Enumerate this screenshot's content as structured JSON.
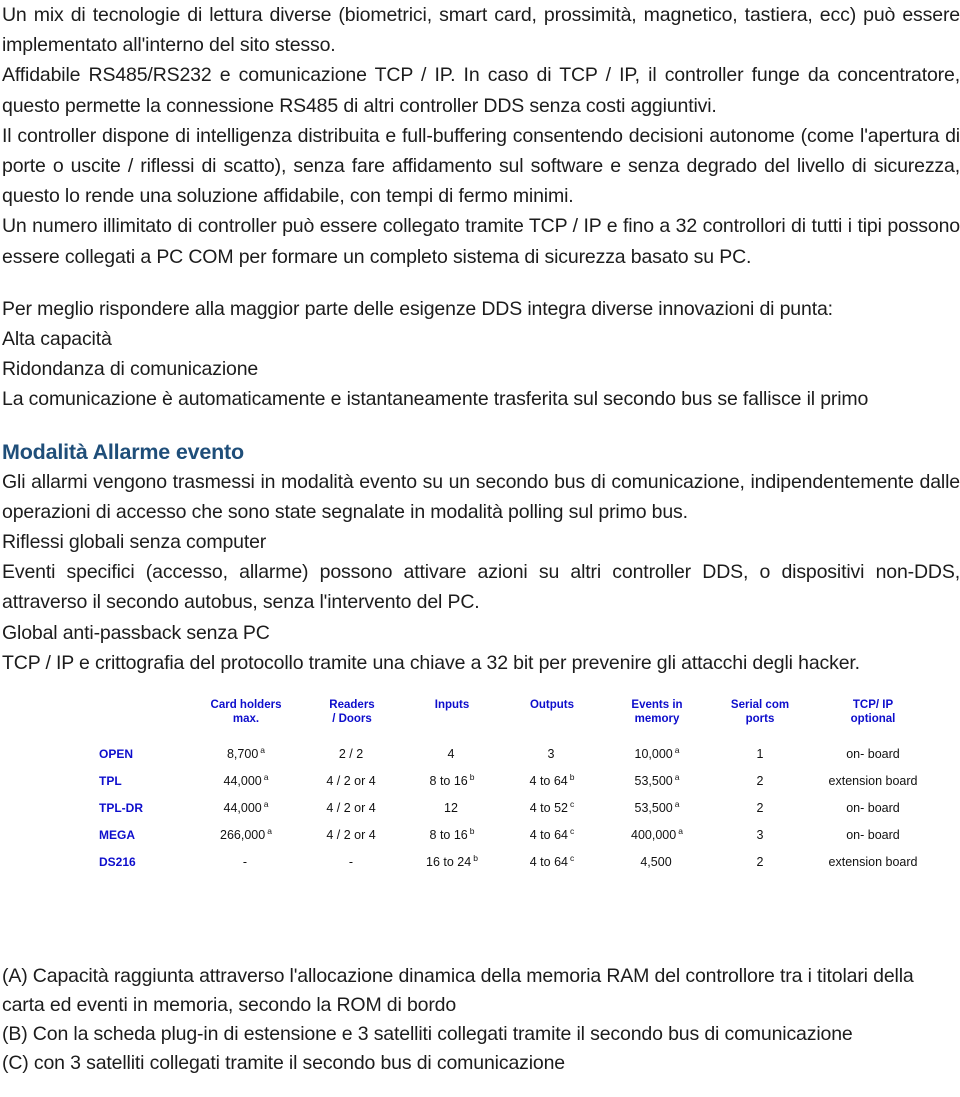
{
  "document": {
    "paragraphs": [
      {
        "id": "p-intro",
        "text": "Un mix di tecnologie di lettura diverse (biometrici, smart card, prossimità, magnetico, tastiera, ecc) può essere implementato all'interno del sito stesso."
      },
      {
        "id": "p-comm",
        "text": "Affidabile RS485/RS232 e comunicazione TCP / IP. In caso di TCP / IP, il controller funge da concentratore, questo permette la connessione RS485 di altri controller DDS senza costi aggiuntivi."
      },
      {
        "id": "p-intelligence",
        "text": "Il controller dispone di intelligenza distribuita e full-buffering consentendo decisioni autonome (come l'apertura di porte o uscite / riflessi di scatto), senza fare affidamento sul software e senza degrado del livello di sicurezza, questo lo rende una soluzione affidabile, con tempi di fermo minimi."
      },
      {
        "id": "p-scaling",
        "text": "Un numero illimitato di controller può essere collegato tramite TCP / IP e fino a 32 controllori di tutti i tipi possono essere collegati a PC COM per formare un completo sistema di sicurezza basato su PC."
      }
    ],
    "innovations": {
      "lead_in": "Per meglio rispondere alla maggior parte delle esigenze DDS integra diverse innovazioni di punta:",
      "items": [
        {
          "title": "Alta capacità",
          "description": ""
        },
        {
          "title": "Ridondanza di comunicazione",
          "description": "La comunicazione è automaticamente e istantaneamente trasferita sul secondo bus se fallisce il primo"
        }
      ]
    },
    "alarm_section": {
      "heading": "Modalità Allarme evento",
      "heading_color": "#1f4e79",
      "body": "Gli allarmi vengono trasmessi in modalità evento su un secondo bus di comunicazione, indipendentemente dalle operazioni di accesso che sono state segnalate in modalità polling sul primo bus.",
      "subsections": [
        {
          "title": "Riflessi globali senza computer",
          "body": "Eventi specifici (accesso, allarme) possono attivare azioni su altri controller DDS, o dispositivi non-DDS, attraverso il secondo autobus, senza l'intervento del PC."
        },
        {
          "title": "Global anti-passback senza PC",
          "body": "TCP / IP e crittografia del protocollo tramite una chiave a 32 bit per prevenire gli attacchi degli hacker."
        }
      ]
    }
  },
  "spec_table": {
    "header_color": "#0d0dcc",
    "columns": [
      {
        "key": "model",
        "line1": "",
        "line2": ""
      },
      {
        "key": "cards",
        "line1": "Card holders",
        "line2": "max."
      },
      {
        "key": "readers",
        "line1": "Readers",
        "line2": "/ Doors"
      },
      {
        "key": "inputs",
        "line1": "Inputs",
        "line2": ""
      },
      {
        "key": "outputs",
        "line1": "Outputs",
        "line2": ""
      },
      {
        "key": "events",
        "line1": "Events in",
        "line2": "memory"
      },
      {
        "key": "serial",
        "line1": "Serial com",
        "line2": "ports"
      },
      {
        "key": "tcp",
        "line1": "TCP/ IP",
        "line2": "optional"
      }
    ],
    "rows": [
      {
        "model": "OPEN",
        "cards": "8,700",
        "cards_fn": "a",
        "readers": "2 / 2",
        "readers_fn": "",
        "inputs": "4",
        "inputs_fn": "",
        "outputs": "3",
        "outputs_fn": "",
        "events": "10,000",
        "events_fn": "a",
        "serial": "1",
        "tcp": "on- board"
      },
      {
        "model": "TPL",
        "cards": "44,000",
        "cards_fn": "a",
        "readers": "4 / 2 or 4",
        "readers_fn": "",
        "inputs": "8 to 16",
        "inputs_fn": "b",
        "outputs": "4 to 64",
        "outputs_fn": "b",
        "events": "53,500",
        "events_fn": "a",
        "serial": "2",
        "tcp": "extension board"
      },
      {
        "model": "TPL-DR",
        "cards": "44,000",
        "cards_fn": "a",
        "readers": "4 / 2 or 4",
        "readers_fn": "",
        "inputs": "12",
        "inputs_fn": "",
        "outputs": "4 to 52",
        "outputs_fn": "c",
        "events": "53,500",
        "events_fn": "a",
        "serial": "2",
        "tcp": "on- board"
      },
      {
        "model": "MEGA",
        "cards": "266,000",
        "cards_fn": "a",
        "readers": "4 / 2 or 4",
        "readers_fn": "",
        "inputs": "8 to 16",
        "inputs_fn": "b",
        "outputs": "4 to 64",
        "outputs_fn": "c",
        "events": "400,000",
        "events_fn": "a",
        "serial": "3",
        "tcp": "on- board"
      },
      {
        "model": "DS216",
        "cards": "-",
        "cards_fn": "",
        "readers": "-",
        "readers_fn": "",
        "inputs": "16 to 24",
        "inputs_fn": "b",
        "outputs": "4 to 64",
        "outputs_fn": "c",
        "events": "4,500",
        "events_fn": "",
        "serial": "2",
        "tcp": "extension board"
      }
    ]
  },
  "footnotes": [
    "(A) Capacità raggiunta attraverso l'allocazione dinamica della memoria RAM del controllore tra i titolari della carta ed eventi in memoria, secondo la ROM di bordo",
    "(B) Con la scheda plug-in di estensione e 3 satelliti collegati tramite il secondo bus di comunicazione",
    "(C) con 3 satelliti collegati tramite il secondo bus di comunicazione"
  ]
}
